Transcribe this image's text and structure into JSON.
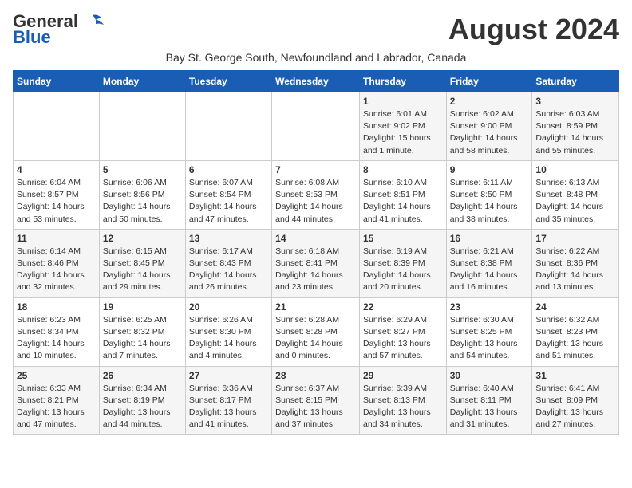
{
  "header": {
    "logo_line1": "General",
    "logo_line2": "Blue",
    "month": "August 2024",
    "subtitle": "Bay St. George South, Newfoundland and Labrador, Canada"
  },
  "days_of_week": [
    "Sunday",
    "Monday",
    "Tuesday",
    "Wednesday",
    "Thursday",
    "Friday",
    "Saturday"
  ],
  "weeks": [
    [
      {
        "day": "",
        "info": ""
      },
      {
        "day": "",
        "info": ""
      },
      {
        "day": "",
        "info": ""
      },
      {
        "day": "",
        "info": ""
      },
      {
        "day": "1",
        "info": "Sunrise: 6:01 AM\nSunset: 9:02 PM\nDaylight: 15 hours\nand 1 minute."
      },
      {
        "day": "2",
        "info": "Sunrise: 6:02 AM\nSunset: 9:00 PM\nDaylight: 14 hours\nand 58 minutes."
      },
      {
        "day": "3",
        "info": "Sunrise: 6:03 AM\nSunset: 8:59 PM\nDaylight: 14 hours\nand 55 minutes."
      }
    ],
    [
      {
        "day": "4",
        "info": "Sunrise: 6:04 AM\nSunset: 8:57 PM\nDaylight: 14 hours\nand 53 minutes."
      },
      {
        "day": "5",
        "info": "Sunrise: 6:06 AM\nSunset: 8:56 PM\nDaylight: 14 hours\nand 50 minutes."
      },
      {
        "day": "6",
        "info": "Sunrise: 6:07 AM\nSunset: 8:54 PM\nDaylight: 14 hours\nand 47 minutes."
      },
      {
        "day": "7",
        "info": "Sunrise: 6:08 AM\nSunset: 8:53 PM\nDaylight: 14 hours\nand 44 minutes."
      },
      {
        "day": "8",
        "info": "Sunrise: 6:10 AM\nSunset: 8:51 PM\nDaylight: 14 hours\nand 41 minutes."
      },
      {
        "day": "9",
        "info": "Sunrise: 6:11 AM\nSunset: 8:50 PM\nDaylight: 14 hours\nand 38 minutes."
      },
      {
        "day": "10",
        "info": "Sunrise: 6:13 AM\nSunset: 8:48 PM\nDaylight: 14 hours\nand 35 minutes."
      }
    ],
    [
      {
        "day": "11",
        "info": "Sunrise: 6:14 AM\nSunset: 8:46 PM\nDaylight: 14 hours\nand 32 minutes."
      },
      {
        "day": "12",
        "info": "Sunrise: 6:15 AM\nSunset: 8:45 PM\nDaylight: 14 hours\nand 29 minutes."
      },
      {
        "day": "13",
        "info": "Sunrise: 6:17 AM\nSunset: 8:43 PM\nDaylight: 14 hours\nand 26 minutes."
      },
      {
        "day": "14",
        "info": "Sunrise: 6:18 AM\nSunset: 8:41 PM\nDaylight: 14 hours\nand 23 minutes."
      },
      {
        "day": "15",
        "info": "Sunrise: 6:19 AM\nSunset: 8:39 PM\nDaylight: 14 hours\nand 20 minutes."
      },
      {
        "day": "16",
        "info": "Sunrise: 6:21 AM\nSunset: 8:38 PM\nDaylight: 14 hours\nand 16 minutes."
      },
      {
        "day": "17",
        "info": "Sunrise: 6:22 AM\nSunset: 8:36 PM\nDaylight: 14 hours\nand 13 minutes."
      }
    ],
    [
      {
        "day": "18",
        "info": "Sunrise: 6:23 AM\nSunset: 8:34 PM\nDaylight: 14 hours\nand 10 minutes."
      },
      {
        "day": "19",
        "info": "Sunrise: 6:25 AM\nSunset: 8:32 PM\nDaylight: 14 hours\nand 7 minutes."
      },
      {
        "day": "20",
        "info": "Sunrise: 6:26 AM\nSunset: 8:30 PM\nDaylight: 14 hours\nand 4 minutes."
      },
      {
        "day": "21",
        "info": "Sunrise: 6:28 AM\nSunset: 8:28 PM\nDaylight: 14 hours\nand 0 minutes."
      },
      {
        "day": "22",
        "info": "Sunrise: 6:29 AM\nSunset: 8:27 PM\nDaylight: 13 hours\nand 57 minutes."
      },
      {
        "day": "23",
        "info": "Sunrise: 6:30 AM\nSunset: 8:25 PM\nDaylight: 13 hours\nand 54 minutes."
      },
      {
        "day": "24",
        "info": "Sunrise: 6:32 AM\nSunset: 8:23 PM\nDaylight: 13 hours\nand 51 minutes."
      }
    ],
    [
      {
        "day": "25",
        "info": "Sunrise: 6:33 AM\nSunset: 8:21 PM\nDaylight: 13 hours\nand 47 minutes."
      },
      {
        "day": "26",
        "info": "Sunrise: 6:34 AM\nSunset: 8:19 PM\nDaylight: 13 hours\nand 44 minutes."
      },
      {
        "day": "27",
        "info": "Sunrise: 6:36 AM\nSunset: 8:17 PM\nDaylight: 13 hours\nand 41 minutes."
      },
      {
        "day": "28",
        "info": "Sunrise: 6:37 AM\nSunset: 8:15 PM\nDaylight: 13 hours\nand 37 minutes."
      },
      {
        "day": "29",
        "info": "Sunrise: 6:39 AM\nSunset: 8:13 PM\nDaylight: 13 hours\nand 34 minutes."
      },
      {
        "day": "30",
        "info": "Sunrise: 6:40 AM\nSunset: 8:11 PM\nDaylight: 13 hours\nand 31 minutes."
      },
      {
        "day": "31",
        "info": "Sunrise: 6:41 AM\nSunset: 8:09 PM\nDaylight: 13 hours\nand 27 minutes."
      }
    ]
  ]
}
